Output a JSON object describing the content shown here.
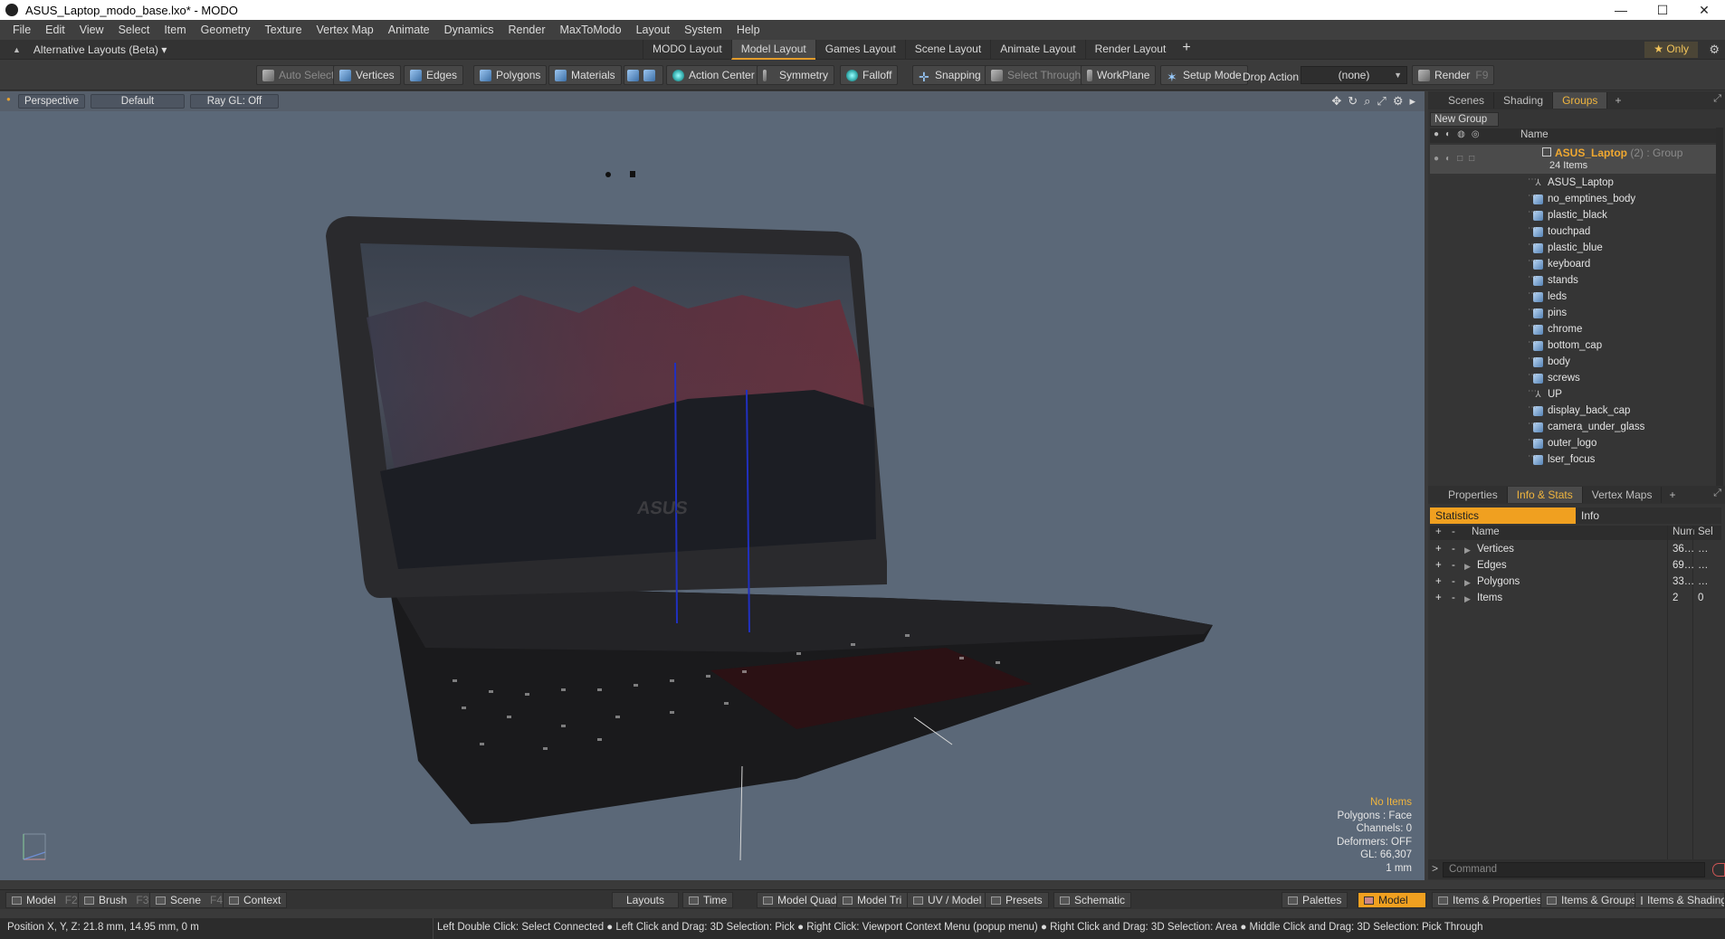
{
  "window": {
    "title": "ASUS_Laptop_modo_base.lxo* - MODO",
    "controls": [
      "—",
      "☐",
      "✕"
    ]
  },
  "menu": [
    "File",
    "Edit",
    "View",
    "Select",
    "Item",
    "Geometry",
    "Texture",
    "Vertex Map",
    "Animate",
    "Dynamics",
    "Render",
    "MaxToModo",
    "Layout",
    "System",
    "Help"
  ],
  "layoutbar": {
    "alt_layouts": "Alternative Layouts (Beta) ▾",
    "tabs": [
      "MODO Layout",
      "Model Layout",
      "Games Layout",
      "Scene Layout",
      "Animate Layout",
      "Render Layout"
    ],
    "active_tab": "Model Layout",
    "plus": "+",
    "only": "★  Only",
    "gear": "⚙"
  },
  "toolbar": {
    "auto_select": "Auto Select",
    "vertices": "Vertices",
    "edges": "Edges",
    "polygons": "Polygons",
    "materials": "Materials",
    "action_center": "Action Center",
    "symmetry": "Symmetry",
    "falloff": "Falloff",
    "snapping": "Snapping",
    "select_through": "Select Through",
    "workplane": "WorkPlane",
    "setup_mode": "Setup Mode",
    "drop_action": "Drop Action",
    "drop_value": "(none)",
    "render": "Render",
    "render_key": "F9"
  },
  "viewport": {
    "perspective": "Perspective",
    "default": "Default",
    "raygl": "Ray GL: Off",
    "brand_text": "ASUS",
    "info": {
      "no_items": "No Items",
      "polygons": "Polygons : Face",
      "channels": "Channels: 0",
      "deformers": "Deformers: OFF",
      "gl": "GL: 66,307",
      "scale": "1 mm"
    }
  },
  "groups_panel": {
    "tabs": [
      "Scenes",
      "Shading",
      "Groups"
    ],
    "active_tab": "Groups",
    "new_group": "New Group",
    "col_name": "Name",
    "group_name": "ASUS_Laptop",
    "group_suffix": " (2) : Group",
    "group_count": "24 Items",
    "items": [
      {
        "name": "ASUS_Laptop",
        "type": "locator"
      },
      {
        "name": "no_emptines_body",
        "type": "mesh"
      },
      {
        "name": "plastic_black",
        "type": "mesh"
      },
      {
        "name": "touchpad",
        "type": "mesh"
      },
      {
        "name": "plastic_blue",
        "type": "mesh"
      },
      {
        "name": "keyboard",
        "type": "mesh"
      },
      {
        "name": "stands",
        "type": "mesh"
      },
      {
        "name": "leds",
        "type": "mesh"
      },
      {
        "name": "pins",
        "type": "mesh"
      },
      {
        "name": "chrome",
        "type": "mesh"
      },
      {
        "name": "bottom_cap",
        "type": "mesh"
      },
      {
        "name": "body",
        "type": "mesh"
      },
      {
        "name": "screws",
        "type": "mesh"
      },
      {
        "name": "UP",
        "type": "locator"
      },
      {
        "name": "display_back_cap",
        "type": "mesh"
      },
      {
        "name": "camera_under_glass",
        "type": "mesh"
      },
      {
        "name": "outer_logo",
        "type": "mesh"
      },
      {
        "name": "lser_focus",
        "type": "mesh"
      }
    ]
  },
  "stats_panel": {
    "tabs": [
      "Properties",
      "Info & Stats",
      "Vertex Maps"
    ],
    "active_tab": "Info & Stats",
    "sub_tabs": [
      "Statistics",
      "Info"
    ],
    "col_plus": "+",
    "col_minus": "-",
    "col_name": "Name",
    "col_num": "Num",
    "col_sel": "Sel",
    "rows": [
      {
        "name": "Vertices",
        "num": "36…",
        "sel": "…"
      },
      {
        "name": "Edges",
        "num": "69…",
        "sel": "…"
      },
      {
        "name": "Polygons",
        "num": "33…",
        "sel": "…"
      },
      {
        "name": "Items",
        "num": "2",
        "sel": "0"
      }
    ]
  },
  "command": {
    "placeholder": "Command"
  },
  "bottombar": {
    "model": "Model",
    "model_key": "F2",
    "brush": "Brush",
    "brush_key": "F3",
    "scene": "Scene",
    "scene_key": "F4",
    "context": "Context",
    "layouts": "Layouts",
    "time": "Time",
    "model_quad": "Model Quad",
    "model_tri": "Model Tri",
    "uv_model": "UV / Model",
    "presets": "Presets",
    "schematic": "Schematic",
    "palettes": "Palettes",
    "model_active": "Model",
    "items_props": "Items & Properties",
    "items_groups": "Items & Groups",
    "items_shading": "Items & Shading"
  },
  "statusbar": {
    "position": "Position X, Y, Z:   21.8 mm, 14.95 mm, 0 m",
    "hint": "Left Double Click: Select Connected ● Left Click and Drag: 3D Selection: Pick ● Right Click: Viewport Context Menu (popup menu) ● Right Click and Drag: 3D Selection: Area ● Middle Click and Drag: 3D Selection: Pick Through"
  }
}
